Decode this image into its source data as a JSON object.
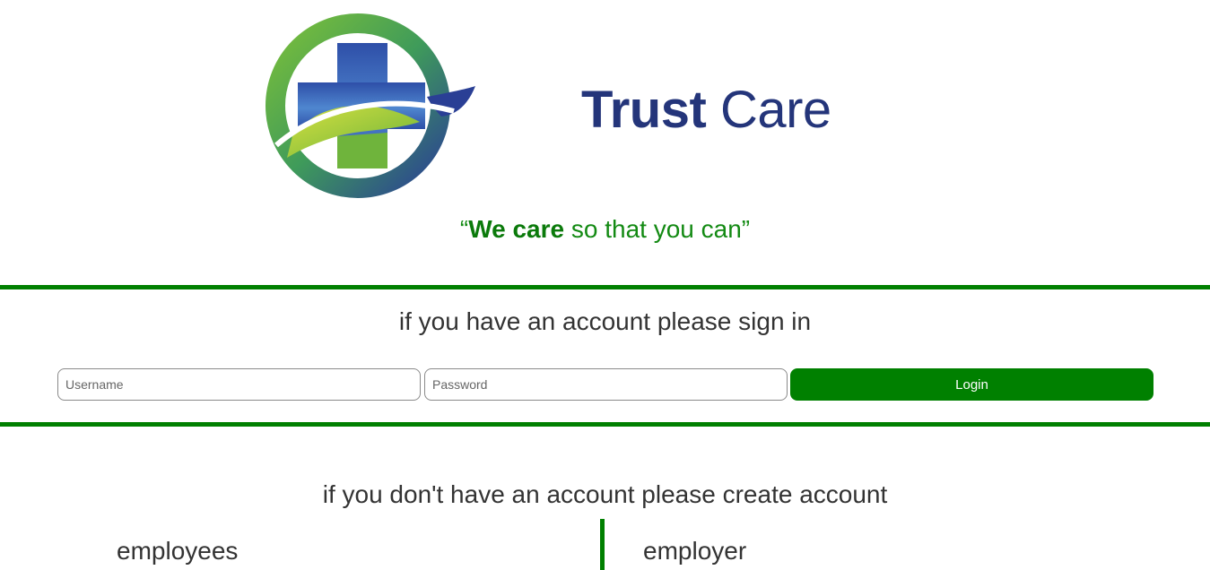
{
  "brand": {
    "name_part1": "Trust",
    "name_part2": "Care",
    "logo_icon": "medical-cross-icon",
    "color": "#24357a"
  },
  "tagline": {
    "open_quote": "“",
    "bold": "We care",
    "rest": " so that you can",
    "close_quote": "”",
    "color": "#008000"
  },
  "signin": {
    "heading": "if you have an account please sign in",
    "username_placeholder": "Username",
    "password_placeholder": "Password",
    "login_label": "Login"
  },
  "signup": {
    "heading": "if you don't have an account please create account",
    "employees_label": "employees",
    "employer_label": "employer"
  },
  "colors": {
    "accent": "#008000"
  }
}
